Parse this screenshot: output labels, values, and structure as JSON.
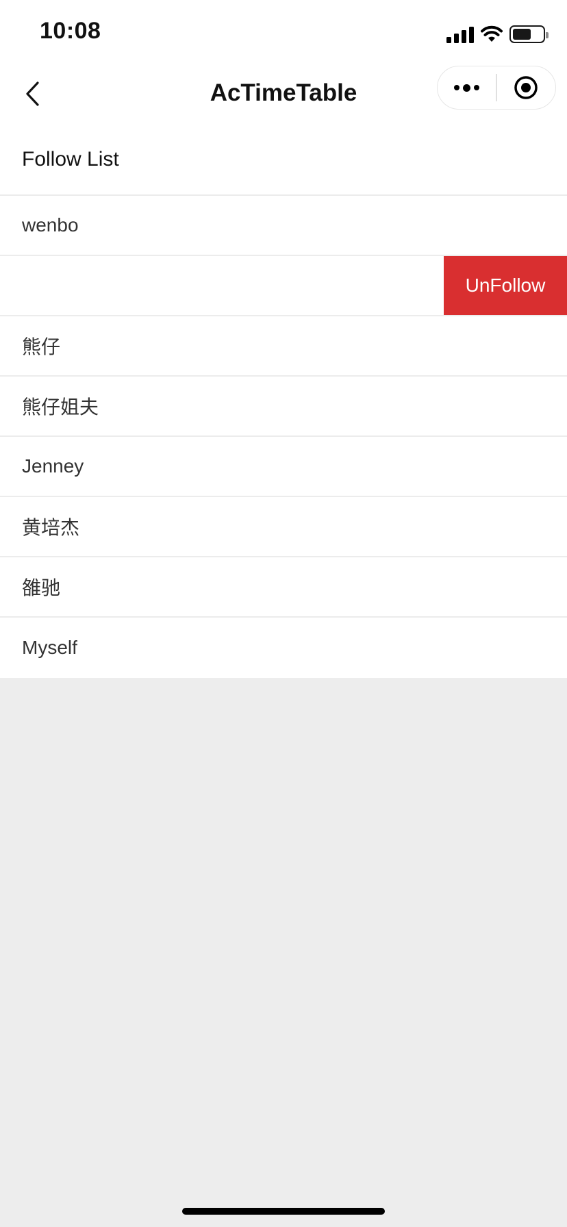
{
  "status_bar": {
    "time": "10:08",
    "icons": [
      "cellular-signal-icon",
      "wifi-icon",
      "battery-icon"
    ]
  },
  "nav": {
    "title": "AcTimeTable",
    "back_icon": "chevron-left-icon",
    "capsule_icons": [
      "more-dots-icon",
      "close-target-icon"
    ]
  },
  "list": {
    "header": "Follow List",
    "rows": [
      {
        "label": "wenbo"
      },
      {
        "label": "",
        "swiped": true,
        "action_label": "UnFollow"
      },
      {
        "label": "熊仔"
      },
      {
        "label": "熊仔姐夫"
      },
      {
        "label": "Jenney"
      },
      {
        "label": "黄培杰"
      },
      {
        "label": "雒驰"
      },
      {
        "label": "Myself"
      }
    ]
  },
  "colors": {
    "page_background": "#ededed",
    "unfollow_button": "#d92f30",
    "divider": "#ececec"
  }
}
